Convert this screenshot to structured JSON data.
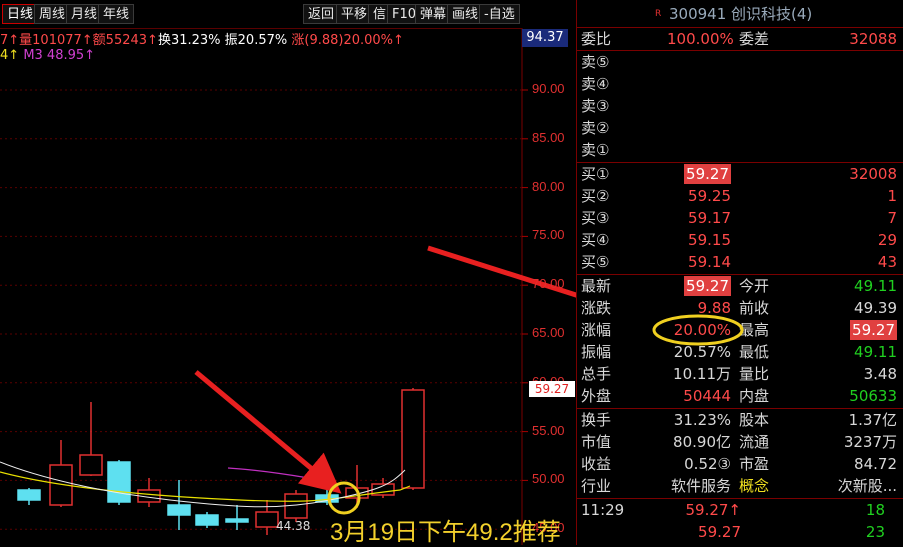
{
  "toolbar": {
    "tabs": [
      "日线",
      "周线",
      "月线",
      "年线"
    ],
    "right_buttons": [
      "返回",
      "平移",
      "信",
      "F10",
      "弹幕",
      "画线",
      "-自选"
    ]
  },
  "info_line": {
    "prefix": "7↑量101077↑额55243↑",
    "turnover": "换31.23%",
    "amplitude": "振20.57%",
    "change": "涨(9.88)20.00%↑"
  },
  "ma_line": {
    "prefix": "4↑",
    "m3": "M3 48.95↑"
  },
  "price_axis": {
    "top_price": "94.37",
    "current_price": "59.27",
    "ticks": [
      "90.00",
      "85.00",
      "80.00",
      "75.00",
      "70.00",
      "65.00",
      "60.00",
      "55.00",
      "50.00",
      "45.00"
    ]
  },
  "candle_low_label": "44.38",
  "caption": "3月19日下午49.2推荐",
  "stock": {
    "marker": "R",
    "title": "300941 创识科技(4)"
  },
  "order_ratio": {
    "label": "委比",
    "value": "100.00%",
    "diff_label": "委差",
    "diff_value": "32088"
  },
  "sells": [
    {
      "label": "卖⑤",
      "price": "",
      "vol": ""
    },
    {
      "label": "卖④",
      "price": "",
      "vol": ""
    },
    {
      "label": "卖③",
      "price": "",
      "vol": ""
    },
    {
      "label": "卖②",
      "price": "",
      "vol": ""
    },
    {
      "label": "卖①",
      "price": "",
      "vol": ""
    }
  ],
  "buys": [
    {
      "label": "买①",
      "price": "59.27",
      "vol": "32008"
    },
    {
      "label": "买②",
      "price": "59.25",
      "vol": "1"
    },
    {
      "label": "买③",
      "price": "59.17",
      "vol": "7"
    },
    {
      "label": "买④",
      "price": "59.15",
      "vol": "29"
    },
    {
      "label": "买⑤",
      "price": "59.14",
      "vol": "43"
    }
  ],
  "quote": {
    "latest_label": "最新",
    "latest": "59.27",
    "open_label": "今开",
    "open": "49.11",
    "change_label": "涨跌",
    "change": "9.88",
    "prev_label": "前收",
    "prev": "49.39",
    "pct_label": "涨幅",
    "pct": "20.00%",
    "high_label": "最高",
    "high": "59.27",
    "amp_label": "振幅",
    "amp": "20.57%",
    "low_label": "最低",
    "low": "49.11",
    "vol_label": "总手",
    "vol": "10.11万",
    "volratio_label": "量比",
    "volratio": "3.48",
    "outer_label": "外盘",
    "outer": "50444",
    "inner_label": "内盘",
    "inner": "50633"
  },
  "fundamentals": {
    "turn_label": "换手",
    "turn": "31.23%",
    "cap_label": "股本",
    "cap": "1.37亿",
    "mv_label": "市值",
    "mv": "80.90亿",
    "float_label": "流通",
    "float": "3237万",
    "eps_label": "收益",
    "eps": "0.52③",
    "pe_label": "市盈",
    "pe": "84.72",
    "ind_label": "行业",
    "ind": "软件服务",
    "concept_label": "概念",
    "concept": "次新股..."
  },
  "ticks": [
    {
      "time": "11:29",
      "price": "59.27↑",
      "vol": "18"
    },
    {
      "time": "",
      "price": "59.27",
      "vol": "23"
    }
  ]
}
